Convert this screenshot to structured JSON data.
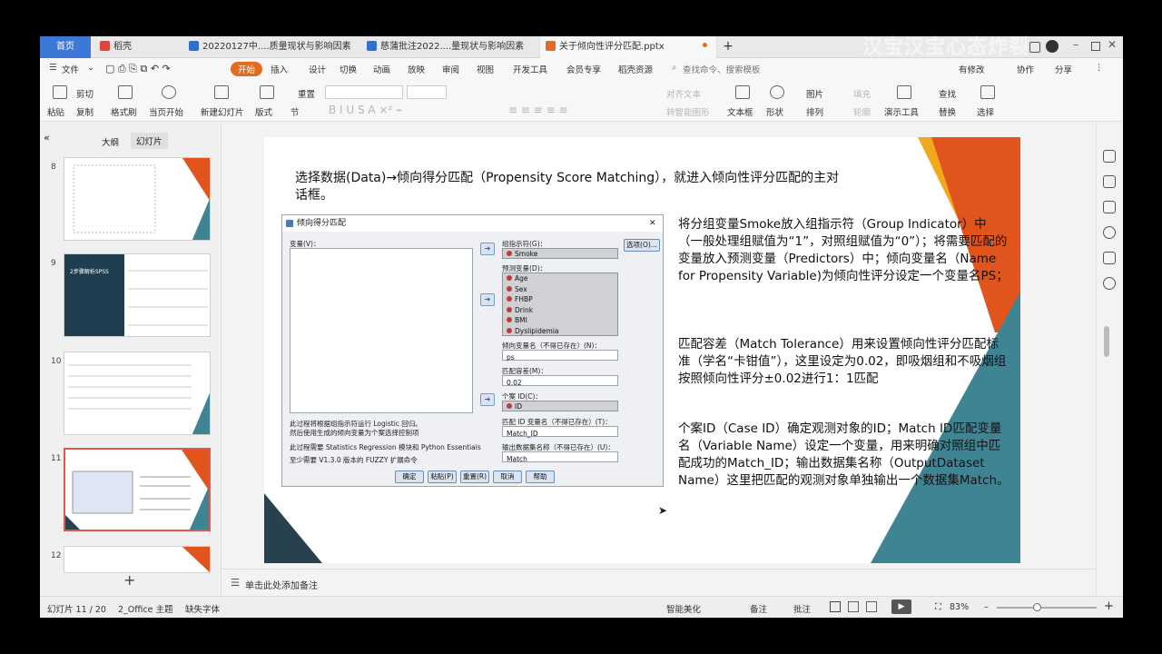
{
  "watermark": "汉宝汉宝心态炸裂",
  "tabs": {
    "home": "首页",
    "daoke": "稻壳",
    "doc1": "20220127中....质量现状与影响因素",
    "doc2": "慈蒲批注2022....量现状与影响因素",
    "ppt": "关于倾向性评分匹配.pptx",
    "plus": "+"
  },
  "menu": [
    "文件",
    "开始",
    "插入",
    "设计",
    "切换",
    "动画",
    "放映",
    "审阅",
    "视图",
    "开发工具",
    "会员专享",
    "稻壳资源"
  ],
  "menu_search": "查找命令、搜索模板",
  "menu_right": {
    "modified": "有修改",
    "collab": "协作",
    "share": "分享"
  },
  "ribbon": {
    "paste": "粘贴",
    "cut": "剪切",
    "copy": "复制",
    "format_painter": "格式刷",
    "from_current": "当页开始",
    "new_slide": "新建幻灯片",
    "layout": "版式",
    "section": "节",
    "reset": "重置",
    "align_text": "对齐文本",
    "to_smartart": "转智能图形",
    "textbox": "文本框",
    "shape": "形状",
    "image": "图片",
    "arrange": "排列",
    "fill": "填充",
    "outline": "轮廓",
    "presenter": "演示工具",
    "find": "查找",
    "replace": "替换",
    "select": "选择"
  },
  "panel_tabs": {
    "outline": "大纲",
    "slides": "幻灯片"
  },
  "thumb_numbers": [
    "8",
    "9",
    "10",
    "11",
    "12"
  ],
  "thumb9_title": "2步骤解析SPSS",
  "slide": {
    "title": "选择数据(Data)→倾向得分匹配（Propensity Score Matching），就进入倾向性评分匹配的主对话框。",
    "para1": "将分组变量Smoke放入组指示符（Group Indicator）中（一般处理组赋值为“1”，对照组赋值为“0”）；将需要匹配的变量放入预测变量（Predictors）中；倾向变量名（Name for Propensity Variable)为倾向性评分设定一个变量名PS；",
    "para2": "匹配容差（Match Tolerance）用来设置倾向性评分匹配标准（学名“卡钳值”），这里设定为0.02，即吸烟组和不吸烟组按照倾向性评分±0.02进行1：1匹配",
    "para3": "个案ID（Case ID）确定观测对象的ID；Match ID匹配变量名（Variable Name）设定一个变量，用来明确对照组中匹配成功的Match_ID；输出数据集名称（OutputDataset Name）这里把匹配的观测对象单独输出一个数据集Match。"
  },
  "dialog": {
    "title": "倾向得分匹配",
    "close": "✕",
    "variables_label": "变量(V)：",
    "group_label": "组指示符(G)：",
    "group_value": "Smoke",
    "options_button": "选项(O)...",
    "predictors_label": "预测变量(D)：",
    "predictors": [
      "Age",
      "Sex",
      "FHBP",
      "Drink",
      "BMI",
      "Dyslipidemia"
    ],
    "propensity_label": "倾向变量名（不得已存在）(N)：",
    "propensity_value": "ps",
    "tolerance_label": "匹配容差(M)：",
    "tolerance_value": "0.02",
    "caseid_label": "个案 ID(C)：",
    "caseid_value": "ID",
    "matchid_label": "匹配 ID 变量名（不得已存在）(T)：",
    "matchid_value": "Match_ID",
    "output_label": "输出数据集名称（不得已存在）(U)：",
    "output_value": "Match",
    "note1": "此过程将根据组指示符运行 Logistic 回归。",
    "note2": "然后使用生成的倾向变量为个案选择控制项",
    "note3": "此过程需要 Statistics Regression 模块和 Python Essentials",
    "note4": "至少需要 V1.3.0 版本的 FUZZY 扩展命令",
    "buttons": [
      "确定",
      "粘贴(P)",
      "重置(R)",
      "取消",
      "帮助"
    ]
  },
  "notes_placeholder": "单击此处添加备注",
  "status": {
    "slide_info": "幻灯片 11 / 20",
    "theme": "2_Office 主题",
    "missing_font": "缺失字体",
    "beautify": "智能美化",
    "notes": "备注",
    "comments": "批注",
    "zoom": "83%"
  },
  "colors": {
    "accent": "#e36b1f",
    "tab_blue": "#3b78d8",
    "slide_orange": "#e1541c",
    "slide_yellow": "#f0a81c",
    "slide_teal": "#3e8493",
    "slide_dark": "#27424d"
  }
}
